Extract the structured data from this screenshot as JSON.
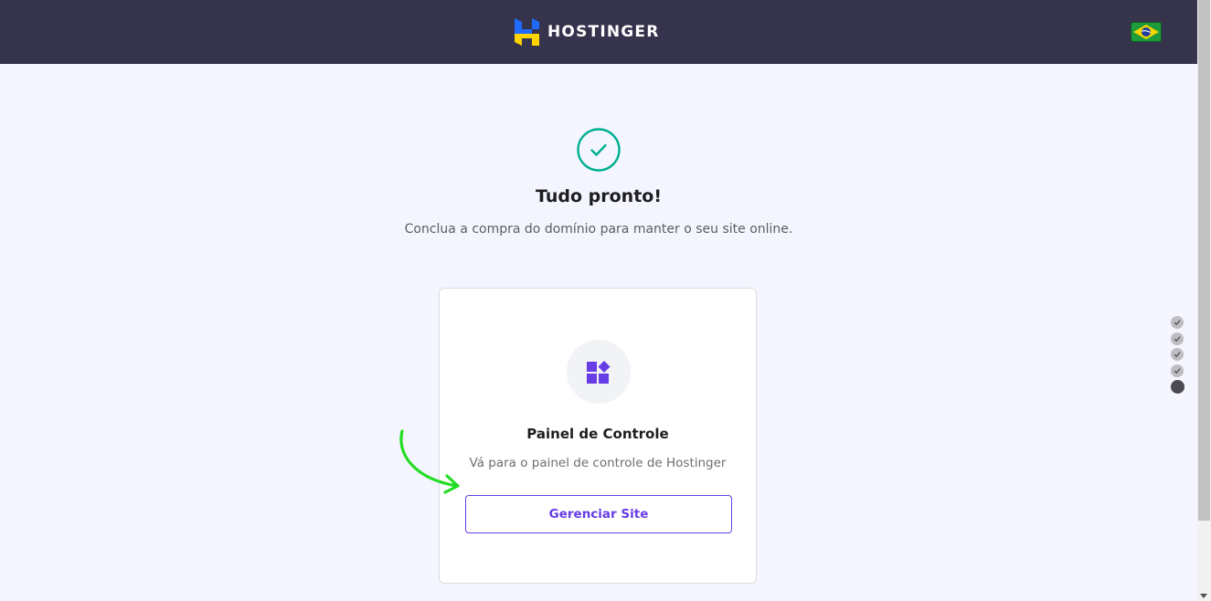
{
  "header": {
    "brand": "HOSTINGER",
    "language_flag": "brazil-flag-icon"
  },
  "success": {
    "icon": "check-circle-icon",
    "title": "Tudo pronto!",
    "subtitle": "Conclua a compra do domínio para manter o seu site online."
  },
  "card": {
    "icon": "widgets-icon",
    "title": "Painel de Controle",
    "description": "Vá para o painel de controle de Hostinger",
    "button_label": "Gerenciar Site"
  },
  "progress": {
    "steps_completed": 4,
    "steps_total": 5
  },
  "colors": {
    "header_bg": "#36344d",
    "accent": "#673de6",
    "success": "#00b090",
    "page_bg": "#f4f5ff",
    "annotation_arrow": "#22dd22"
  }
}
